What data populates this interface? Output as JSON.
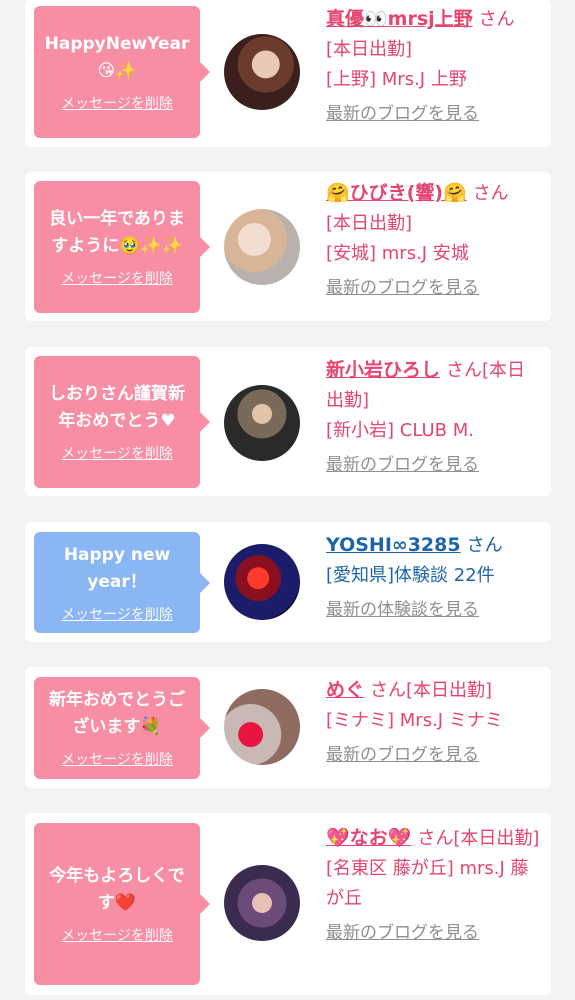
{
  "entries": [
    {
      "message": "HappyNewYear😘✨",
      "delete_label": "メッセージを削除",
      "name": "真優👀mrsj上野",
      "suffix": "さん",
      "lines": [
        "[本日出勤]",
        "[上野] Mrs.J 上野"
      ],
      "more_label": "最新のブログを見る",
      "theme": "pink"
    },
    {
      "message": "良い一年でありますように🥹✨✨",
      "delete_label": "メッセージを削除",
      "name": "🤗ひびき(響)🤗",
      "suffix": "さん",
      "lines": [
        "[本日出勤]",
        "[安城] mrs.J 安城"
      ],
      "more_label": "最新のブログを見る",
      "theme": "pink"
    },
    {
      "message": "しおりさん謹賀新年おめでとう♥",
      "delete_label": "メッセージを削除",
      "name": "新小岩ひろし",
      "suffix": "さん[本日出勤]",
      "lines": [
        "[新小岩] CLUB M."
      ],
      "more_label": "最新のブログを見る",
      "theme": "pink"
    },
    {
      "message": "Happy new year！",
      "delete_label": "メッセージを削除",
      "name": "YOSHI∞3285",
      "suffix": "さん",
      "lines": [
        "[愛知県]体験談 22件"
      ],
      "more_label": "最新の体験談を見る",
      "theme": "blue"
    },
    {
      "message": "新年おめでとうございます💐",
      "delete_label": "メッセージを削除",
      "name": "めぐ",
      "suffix": "さん[本日出勤]",
      "lines": [
        "[ミナミ] Mrs.J ミナミ"
      ],
      "more_label": "最新のブログを見る",
      "theme": "pink"
    },
    {
      "message": "今年もよろしくです❤️",
      "delete_label": "メッセージを削除",
      "name": "💖なお💖",
      "suffix": "さん[本日出勤]",
      "lines": [
        "[名東区 藤が丘] mrs.J 藤が丘"
      ],
      "more_label": "最新のブログを見る",
      "theme": "pink"
    }
  ]
}
